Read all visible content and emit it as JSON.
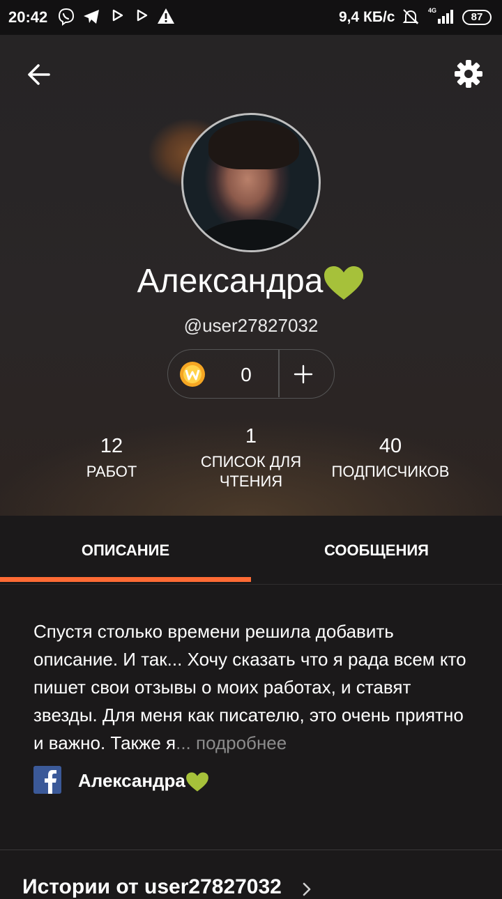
{
  "status_bar": {
    "time": "20:42",
    "speed": "9,4 КБ/с",
    "network": "4G",
    "battery": "87"
  },
  "profile": {
    "name": "Александра",
    "handle": "@user27827032",
    "coins": "0"
  },
  "stats": {
    "works": {
      "value": "12",
      "label": "РАБОТ"
    },
    "reading_lists": {
      "value": "1",
      "label_line1": "СПИСОК ДЛЯ",
      "label_line2": "ЧТЕНИЯ"
    },
    "followers": {
      "value": "40",
      "label": "ПОДПИСЧИКОВ"
    }
  },
  "tabs": [
    {
      "label": "ОПИСАНИЕ",
      "active": true
    },
    {
      "label": "СООБЩЕНИЯ",
      "active": false
    }
  ],
  "description": {
    "text": "Спустя столько времени решила добавить описание. И так... Хочу сказать что я рада всем кто пишет свои отзывы о моих работах, и ставят звезды. Для меня как писателю, это очень приятно и важно. Также я",
    "ellipsis": "... ",
    "more_label": "подробнее"
  },
  "facebook": {
    "name": "Александра"
  },
  "stories": {
    "title": "Истории от user27827032"
  },
  "colors": {
    "accent": "#ff6b35",
    "heart": "#a6c13a",
    "coin": "#f5a623",
    "facebook": "#3b5998"
  }
}
